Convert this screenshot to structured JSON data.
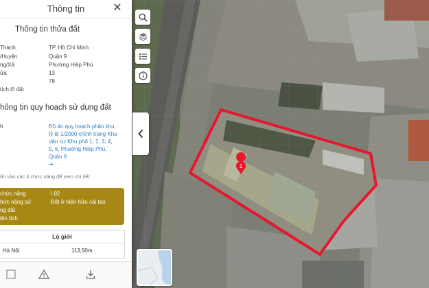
{
  "panel": {
    "title": "Thông tin",
    "section_land": "Thông tin thửa đất",
    "land_rows": [
      {
        "key": "Thành",
        "value": "TP. Hồ Chí Minh"
      },
      {
        "key": "/Huyện",
        "value": "Quận 9"
      },
      {
        "key": "ng/Xã",
        "value": "Phường Hiệp Phú"
      },
      {
        "key": "ửa",
        "value": "13"
      },
      {
        "key": "",
        "value": "78"
      },
      {
        "key": "tích lô đất",
        "value": ""
      }
    ],
    "section_planning": "hông tin quy hoạch sử dụng đất",
    "planning_label": "h",
    "planning_link": "Đồ án quy hoạch phân khu tỷ lệ 1/2000 chỉnh trang Khu dân cư Khu phố 1, 2, 3, 4, 5, 6, Phường Hiệp Phú, Quận 9",
    "link_arrow": "➔",
    "hint": "ấn vào các ô chức năng để xem chi tiết",
    "function": {
      "k1": "chức năng",
      "v1": "I.02",
      "k2": "hức năng sử",
      "v2": "Đất ở hiện hữu cải tạo",
      "k3": "ng đất",
      "k4": "iện tích"
    },
    "boundary": {
      "heading": "Lộ giới",
      "road": "Hà Nội",
      "value": "113,50m"
    },
    "close": "✕"
  },
  "map": {
    "marker_label": "1",
    "parcel_color": "#e8152d",
    "icons": [
      "search-icon",
      "layers-icon",
      "list-icon",
      "info-icon",
      "chevron-left-icon"
    ]
  }
}
